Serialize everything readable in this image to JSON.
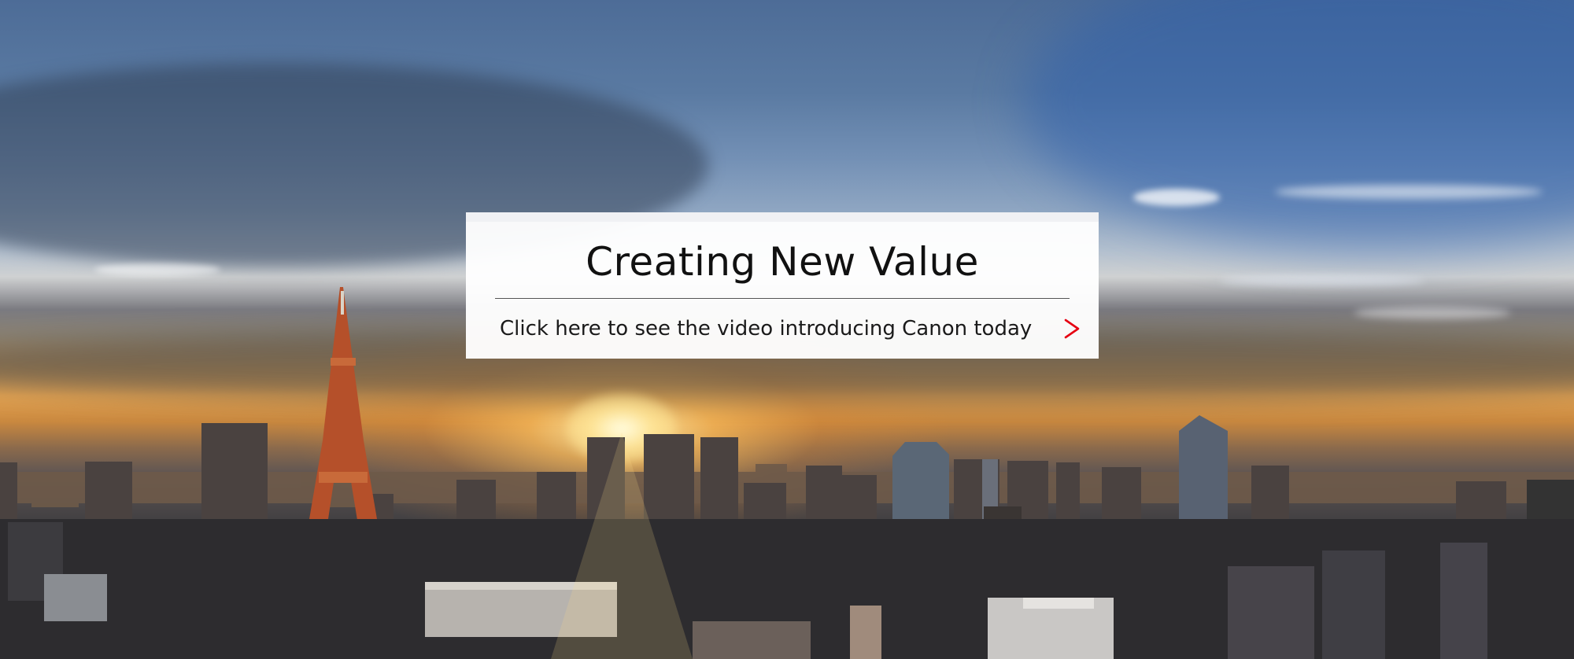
{
  "banner": {
    "title": "Creating New Value",
    "link_text": "Click here to see the video introducing Canon today",
    "accent_color": "#e60012"
  },
  "icons": {
    "link_arrow": "chevron-right-icon"
  }
}
